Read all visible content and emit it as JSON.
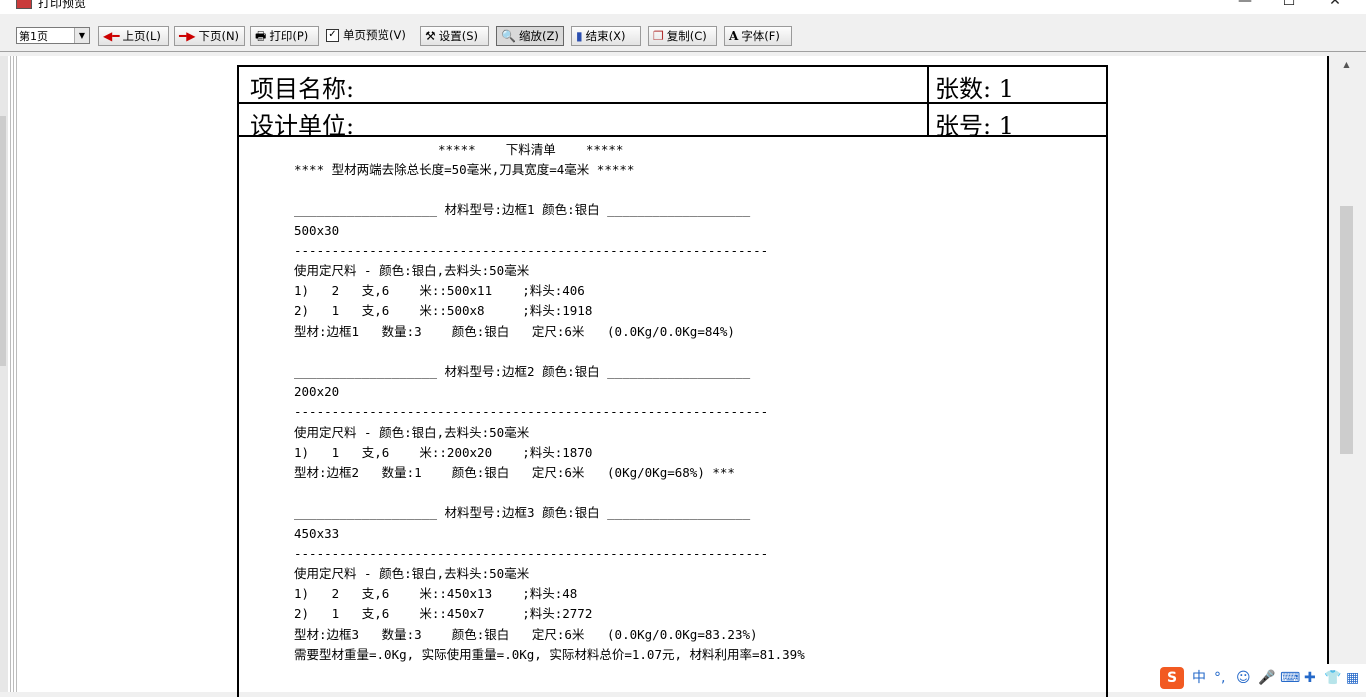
{
  "window": {
    "title": "打印预览",
    "minimize": "—",
    "maximize": "☐",
    "close": "✕"
  },
  "toolbar": {
    "page_select": "第1页",
    "prev": "上页(L)",
    "next": "下页(N)",
    "print": "打印(P)",
    "single_page": "单页预览(V)",
    "single_page_checked": "✓",
    "settings": "设置(S)",
    "zoom": "缩放(Z)",
    "finish": "结束(X)",
    "copy": "复制(C)",
    "font": "字体(F)"
  },
  "header": {
    "project_label": "项目名称:",
    "sheet_count": "张数: 1",
    "design_unit_label": "设计单位:",
    "sheet_no": "张号: 1"
  },
  "report": {
    "title": "*****    下料清单    *****",
    "lines": [
      "**** 型材两端去除总长度=50毫米,刀具宽度=4毫米 *****",
      "",
      "___________________ 材料型号:边框1 颜色:银白 ___________________",
      "500x30",
      "---------------------------------------------------------------",
      "使用定尺料 - 颜色:银白,去料头:50毫米",
      "1)   2   支,6    米::500x11    ;料头:406",
      "2)   1   支,6    米::500x8     ;料头:1918",
      "型材:边框1   数量:3    颜色:银白   定尺:6米   (0.0Kg/0.0Kg=84%)",
      "",
      "___________________ 材料型号:边框2 颜色:银白 ___________________",
      "200x20",
      "---------------------------------------------------------------",
      "使用定尺料 - 颜色:银白,去料头:50毫米",
      "1)   1   支,6    米::200x20    ;料头:1870",
      "型材:边框2   数量:1    颜色:银白   定尺:6米   (0Kg/0Kg=68%) ***",
      "",
      "___________________ 材料型号:边框3 颜色:银白 ___________________",
      "450x33",
      "---------------------------------------------------------------",
      "使用定尺料 - 颜色:银白,去料头:50毫米",
      "1)   2   支,6    米::450x13    ;料头:48",
      "2)   1   支,6    米::450x7     ;料头:2772",
      "型材:边框3   数量:3    颜色:银白   定尺:6米   (0.0Kg/0.0Kg=83.23%)",
      "需要型材重量=.0Kg, 实际使用重量=.0Kg, 实际材料总价=1.07元, 材料利用率=81.39%"
    ]
  },
  "tray": {
    "logo": "S",
    "lang": "中",
    "punct": "°,",
    "emoji": "☺",
    "mic": "🎤",
    "keyboard": "⌨",
    "tools": "✚",
    "shirt": "👕",
    "grid": "▦"
  }
}
